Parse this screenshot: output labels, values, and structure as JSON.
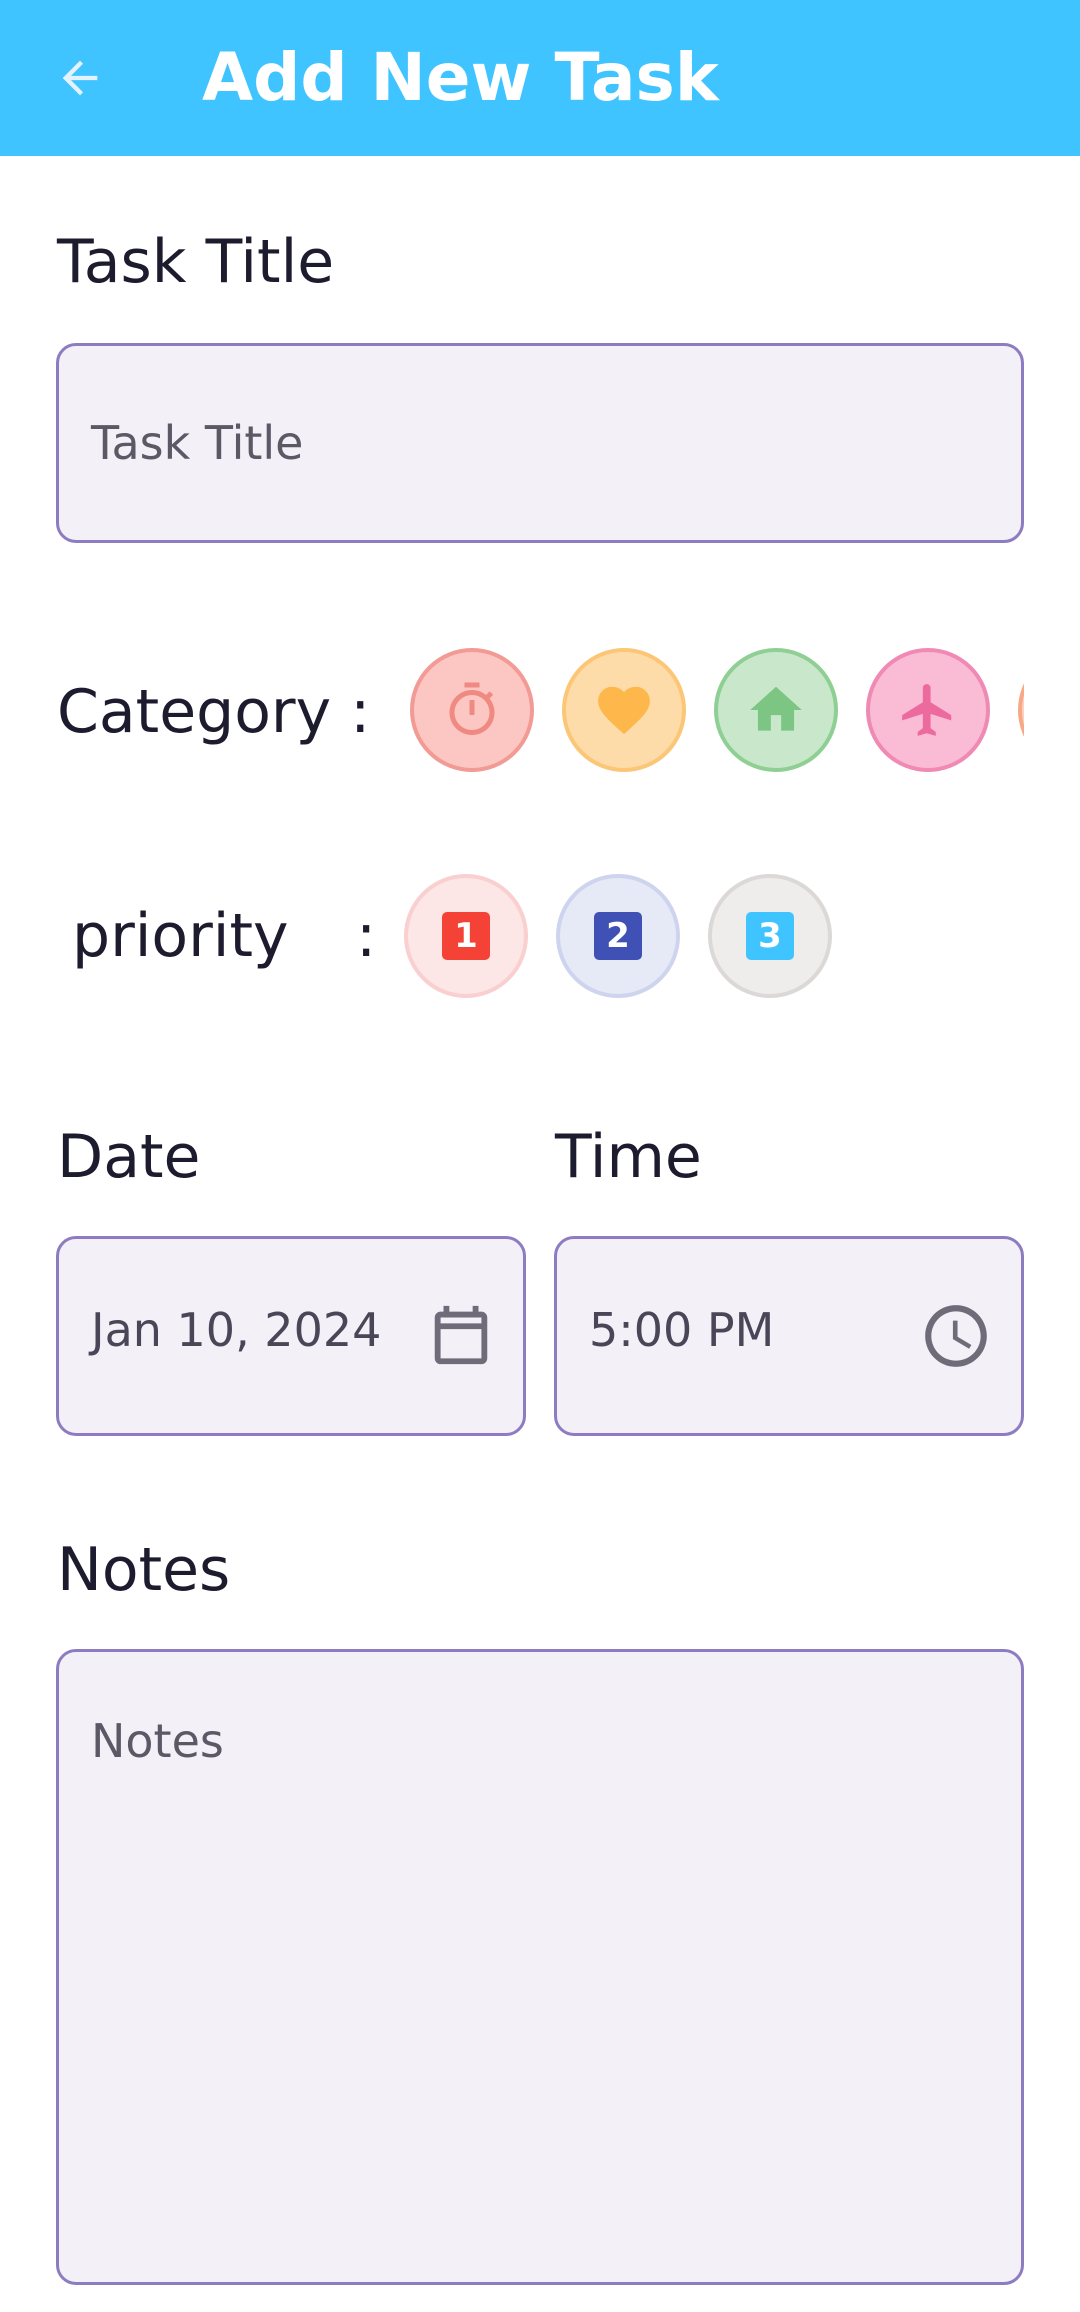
{
  "appbar": {
    "title": "Add New Task"
  },
  "task_title": {
    "label": "Task Title",
    "placeholder": "Task Title"
  },
  "category": {
    "label": "Category :",
    "items": [
      {
        "icon": "stopwatch-icon",
        "bg": "#fcc6c2",
        "border": "#f29a94",
        "color": "#ef8a82"
      },
      {
        "icon": "heart-icon",
        "bg": "#fedcaa",
        "border": "#fcc677",
        "color": "#fdb74a"
      },
      {
        "icon": "home-icon",
        "bg": "#c9e8cb",
        "border": "#8fcf93",
        "color": "#7cc582"
      },
      {
        "icon": "airplane-icon",
        "bg": "#f9bcd4",
        "border": "#f08ab4",
        "color": "#ec6a9e"
      }
    ]
  },
  "priority": {
    "label": "priority",
    "separator": ":",
    "items": [
      {
        "value": "1",
        "box": "#f44336",
        "bg": "#fde6e6",
        "border": "#f9cfcf"
      },
      {
        "value": "2",
        "box": "#3f51b5",
        "bg": "#e6e9f6",
        "border": "#cfd4ee"
      },
      {
        "value": "3",
        "box": "#40c4ff",
        "bg": "#efecec",
        "border": "#dcd8d8"
      }
    ]
  },
  "date": {
    "label": "Date",
    "value": "Jan 10, 2024"
  },
  "time": {
    "label": "Time",
    "value": "5:00 PM"
  },
  "notes": {
    "label": "Notes",
    "placeholder": "Notes"
  }
}
